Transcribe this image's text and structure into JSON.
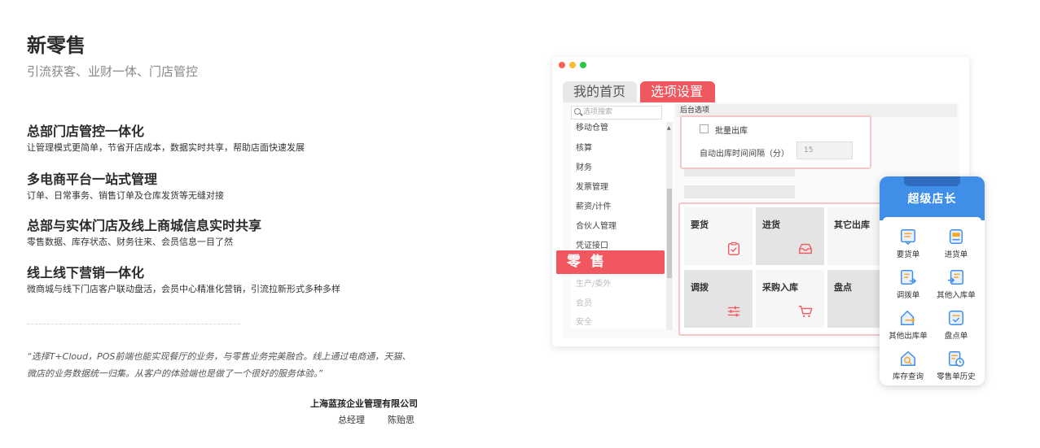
{
  "page": {
    "title": "新零售",
    "subtitle": "引流获客、业财一体、门店管控"
  },
  "features": [
    {
      "title": "总部门店管控一体化",
      "desc": "让管理模式更简单，节省开店成本，数据实时共享，帮助店面快速发展"
    },
    {
      "title": "多电商平台一站式管理",
      "desc": "订单、日常事务、销售订单及仓库发货等无缝对接"
    },
    {
      "title": "总部与实体门店及线上商城信息实时共享",
      "desc": "零售数据、库存状态、财务往来、会员信息一目了然"
    },
    {
      "title": "线上线下营销一体化",
      "desc": "微商城与线下门店客户联动盘活，会员中心精准化营销，引流拉新形式多种多样"
    }
  ],
  "testimonial": {
    "quote": "“选择T+Cloud，POS前端也能实现餐厅的业务，与零售业务完美融合。线上通过电商通，天猫、微店的业务数据统一归集。从客户的体验端也是做了一个很好的服务体验。”",
    "company": "上海蓝孩企业管理有限公司",
    "role": "总经理",
    "name": "陈贻思"
  },
  "app": {
    "tabs": [
      "我的首页",
      "选项设置"
    ],
    "search_placeholder": "选项搜索",
    "sidebar_items": [
      "移动仓管",
      "核算",
      "财务",
      "发票管理",
      "薪资/计件",
      "合伙人管理",
      "凭证接口"
    ],
    "sidebar_highlight": "零 售",
    "sidebar_items_after": [
      "生产/委外",
      "会员",
      "安全"
    ],
    "section_header": "后台选项",
    "popup": {
      "checkbox_label": "批量出库",
      "interval_label": "自动出库时间间隔（分）",
      "interval_value": "15"
    },
    "grid": [
      "要货",
      "进货",
      "其它出库",
      "调拨",
      "采购入库",
      "盘点"
    ]
  },
  "mobile": {
    "title": "超级店长",
    "items": [
      {
        "label": "要货单",
        "icon": "requisition-icon"
      },
      {
        "label": "进货单",
        "icon": "purchase-icon"
      },
      {
        "label": "调拨单",
        "icon": "transfer-icon"
      },
      {
        "label": "其他入库单",
        "icon": "stock-in-icon"
      },
      {
        "label": "其他出库单",
        "icon": "stock-out-icon"
      },
      {
        "label": "盘点单",
        "icon": "inventory-count-icon"
      },
      {
        "label": "库存查询",
        "icon": "stock-query-icon"
      },
      {
        "label": "零售单历史",
        "icon": "retail-history-icon"
      }
    ]
  },
  "colors": {
    "accent_red": "#f0575f",
    "mobile_blue": "#3f8ee8"
  }
}
